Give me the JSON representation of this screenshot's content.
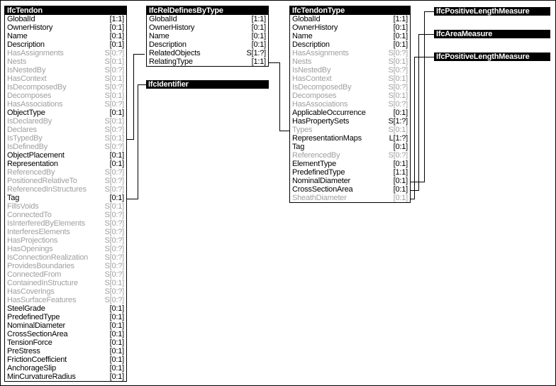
{
  "diagram": {
    "title": "IfcTendon entity relationship diagram",
    "colors": {
      "line": "#000000",
      "header_bg": "#000000",
      "header_fg": "#ffffff",
      "direct_attr": "#000000",
      "inverse_attr": "#a0a0a0"
    }
  },
  "entities": [
    {
      "id": "IfcTendon",
      "name": "IfcTendon",
      "attributes": [
        {
          "name": "GlobalId",
          "card": "[1:1]",
          "kind": "direct"
        },
        {
          "name": "OwnerHistory",
          "card": "[0:1]",
          "kind": "direct"
        },
        {
          "name": "Name",
          "card": "[0:1]",
          "kind": "direct"
        },
        {
          "name": "Description",
          "card": "[0:1]",
          "kind": "direct"
        },
        {
          "name": "HasAssignments",
          "card": "S[0:?]",
          "kind": "inverse"
        },
        {
          "name": "Nests",
          "card": "S[0:1]",
          "kind": "inverse"
        },
        {
          "name": "IsNestedBy",
          "card": "S[0:?]",
          "kind": "inverse"
        },
        {
          "name": "HasContext",
          "card": "S[0:1]",
          "kind": "inverse"
        },
        {
          "name": "IsDecomposedBy",
          "card": "S[0:?]",
          "kind": "inverse"
        },
        {
          "name": "Decomposes",
          "card": "S[0:1]",
          "kind": "inverse"
        },
        {
          "name": "HasAssociations",
          "card": "S[0:?]",
          "kind": "inverse"
        },
        {
          "name": "ObjectType",
          "card": "[0:1]",
          "kind": "direct"
        },
        {
          "name": "IsDeclaredBy",
          "card": "S[0:1]",
          "kind": "inverse"
        },
        {
          "name": "Declares",
          "card": "S[0:?]",
          "kind": "inverse"
        },
        {
          "name": "IsTypedBy",
          "card": "S[0:1]",
          "kind": "inverse"
        },
        {
          "name": "IsDefinedBy",
          "card": "S[0:?]",
          "kind": "inverse"
        },
        {
          "name": "ObjectPlacement",
          "card": "[0:1]",
          "kind": "direct"
        },
        {
          "name": "Representation",
          "card": "[0:1]",
          "kind": "direct"
        },
        {
          "name": "ReferencedBy",
          "card": "S[0:?]",
          "kind": "inverse"
        },
        {
          "name": "PositionedRelativeTo",
          "card": "S[0:?]",
          "kind": "inverse"
        },
        {
          "name": "ReferencedInStructures",
          "card": "S[0:?]",
          "kind": "inverse"
        },
        {
          "name": "Tag",
          "card": "[0:1]",
          "kind": "direct"
        },
        {
          "name": "FillsVoids",
          "card": "S[0:1]",
          "kind": "inverse"
        },
        {
          "name": "ConnectedTo",
          "card": "S[0:?]",
          "kind": "inverse"
        },
        {
          "name": "IsInterferedByElements",
          "card": "S[0:?]",
          "kind": "inverse"
        },
        {
          "name": "InterferesElements",
          "card": "S[0:?]",
          "kind": "inverse"
        },
        {
          "name": "HasProjections",
          "card": "S[0:?]",
          "kind": "inverse"
        },
        {
          "name": "HasOpenings",
          "card": "S[0:?]",
          "kind": "inverse"
        },
        {
          "name": "IsConnectionRealization",
          "card": "S[0:?]",
          "kind": "inverse"
        },
        {
          "name": "ProvidesBoundaries",
          "card": "S[0:?]",
          "kind": "inverse"
        },
        {
          "name": "ConnectedFrom",
          "card": "S[0:?]",
          "kind": "inverse"
        },
        {
          "name": "ContainedInStructure",
          "card": "S[0:1]",
          "kind": "inverse"
        },
        {
          "name": "HasCoverings",
          "card": "S[0:?]",
          "kind": "inverse"
        },
        {
          "name": "HasSurfaceFeatures",
          "card": "S[0:?]",
          "kind": "inverse"
        },
        {
          "name": "SteelGrade",
          "card": "[0:1]",
          "kind": "direct"
        },
        {
          "name": "PredefinedType",
          "card": "[0:1]",
          "kind": "direct"
        },
        {
          "name": "NominalDiameter",
          "card": "[0:1]",
          "kind": "direct"
        },
        {
          "name": "CrossSectionArea",
          "card": "[0:1]",
          "kind": "direct"
        },
        {
          "name": "TensionForce",
          "card": "[0:1]",
          "kind": "direct"
        },
        {
          "name": "PreStress",
          "card": "[0:1]",
          "kind": "direct"
        },
        {
          "name": "FrictionCoefficient",
          "card": "[0:1]",
          "kind": "direct"
        },
        {
          "name": "AnchorageSlip",
          "card": "[0:1]",
          "kind": "direct"
        },
        {
          "name": "MinCurvatureRadius",
          "card": "[0:1]",
          "kind": "direct"
        }
      ]
    },
    {
      "id": "IfcRelDefinesByType",
      "name": "IfcRelDefinesByType",
      "attributes": [
        {
          "name": "GlobalId",
          "card": "[1:1]",
          "kind": "direct"
        },
        {
          "name": "OwnerHistory",
          "card": "[0:1]",
          "kind": "direct"
        },
        {
          "name": "Name",
          "card": "[0:1]",
          "kind": "direct"
        },
        {
          "name": "Description",
          "card": "[0:1]",
          "kind": "direct"
        },
        {
          "name": "RelatedObjects",
          "card": "S[1:?]",
          "kind": "direct"
        },
        {
          "name": "RelatingType",
          "card": "[1:1]",
          "kind": "direct"
        }
      ]
    },
    {
      "id": "IfcTendonType",
      "name": "IfcTendonType",
      "attributes": [
        {
          "name": "GlobalId",
          "card": "[1:1]",
          "kind": "direct"
        },
        {
          "name": "OwnerHistory",
          "card": "[0:1]",
          "kind": "direct"
        },
        {
          "name": "Name",
          "card": "[0:1]",
          "kind": "direct"
        },
        {
          "name": "Description",
          "card": "[0:1]",
          "kind": "direct"
        },
        {
          "name": "HasAssignments",
          "card": "S[0:?]",
          "kind": "inverse"
        },
        {
          "name": "Nests",
          "card": "S[0:1]",
          "kind": "inverse"
        },
        {
          "name": "IsNestedBy",
          "card": "S[0:?]",
          "kind": "inverse"
        },
        {
          "name": "HasContext",
          "card": "S[0:1]",
          "kind": "inverse"
        },
        {
          "name": "IsDecomposedBy",
          "card": "S[0:?]",
          "kind": "inverse"
        },
        {
          "name": "Decomposes",
          "card": "S[0:1]",
          "kind": "inverse"
        },
        {
          "name": "HasAssociations",
          "card": "S[0:?]",
          "kind": "inverse"
        },
        {
          "name": "ApplicableOccurrence",
          "card": "[0:1]",
          "kind": "direct"
        },
        {
          "name": "HasPropertySets",
          "card": "S[1:?]",
          "kind": "direct"
        },
        {
          "name": "Types",
          "card": "S[0:1]",
          "kind": "inverse"
        },
        {
          "name": "RepresentationMaps",
          "card": "L[1:?]",
          "kind": "direct"
        },
        {
          "name": "Tag",
          "card": "[0:1]",
          "kind": "direct"
        },
        {
          "name": "ReferencedBy",
          "card": "S[0:?]",
          "kind": "inverse"
        },
        {
          "name": "ElementType",
          "card": "[0:1]",
          "kind": "direct"
        },
        {
          "name": "PredefinedType",
          "card": "[1:1]",
          "kind": "direct"
        },
        {
          "name": "NominalDiameter",
          "card": "[0:1]",
          "kind": "direct"
        },
        {
          "name": "CrossSectionArea",
          "card": "[0:1]",
          "kind": "direct"
        },
        {
          "name": "SheathDiameter",
          "card": "[0:1]",
          "kind": "direct"
        }
      ]
    }
  ],
  "types": [
    {
      "id": "IfcIdentifier",
      "name": "IfcIdentifier"
    },
    {
      "id": "IfcPositiveLengthMeasure1",
      "name": "IfcPositiveLengthMeasure"
    },
    {
      "id": "IfcAreaMeasure",
      "name": "IfcAreaMeasure"
    },
    {
      "id": "IfcPositiveLengthMeasure2",
      "name": "IfcPositiveLengthMeasure"
    }
  ],
  "relationships": [
    {
      "from": "IfcTendon.IsTypedBy",
      "to": "IfcRelDefinesByType.RelatedObjects"
    },
    {
      "from": "IfcTendon.Tag",
      "to": "IfcIdentifier"
    },
    {
      "from": "IfcRelDefinesByType.RelatingType",
      "to": "IfcTendonType"
    },
    {
      "from": "IfcTendonType.NominalDiameter",
      "to": "IfcPositiveLengthMeasure1"
    },
    {
      "from": "IfcTendonType.CrossSectionArea",
      "to": "IfcAreaMeasure"
    },
    {
      "from": "IfcTendonType.SheathDiameter",
      "to": "IfcPositiveLengthMeasure2"
    }
  ]
}
